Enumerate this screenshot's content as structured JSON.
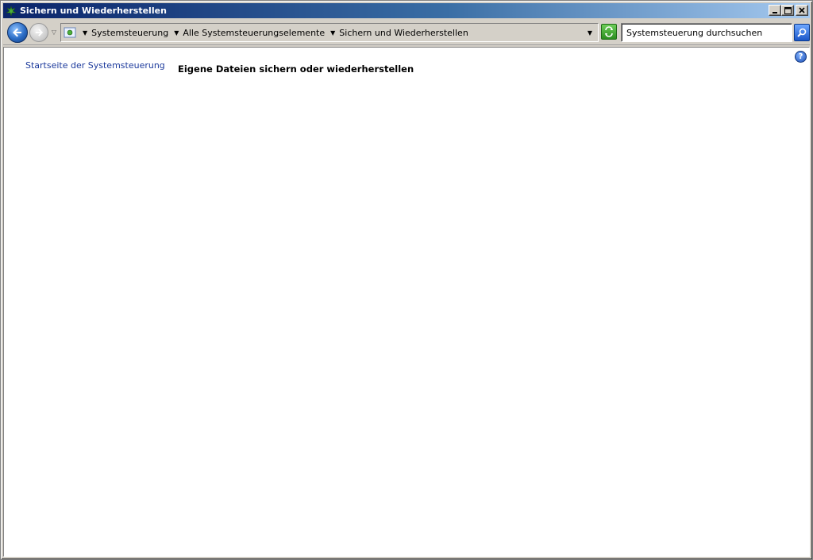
{
  "window": {
    "title": "Sichern und Wiederherstellen",
    "icon": "backup-restore-icon",
    "buttons": {
      "minimize": "minimize",
      "maximize": "maximize",
      "close": "close"
    }
  },
  "navigation": {
    "back": "back-arrow-icon",
    "forward": "forward-arrow-icon",
    "breadcrumbs": [
      {
        "label": "Systemsteuerung"
      },
      {
        "label": "Alle Systemsteuerungselemente"
      },
      {
        "label": "Sichern und Wiederherstellen"
      }
    ]
  },
  "search": {
    "placeholder": "Systemsteuerung durchsuchen"
  },
  "sidebar": {
    "home_link": "Startseite der Systemsteuerung"
  },
  "main": {
    "heading": "Eigene Dateien sichern oder wiederherstellen"
  },
  "colors": {
    "titlebar_start": "#0a246a",
    "titlebar_end": "#a6caf0",
    "link": "#1c3a9c",
    "background": "#ffffff"
  }
}
